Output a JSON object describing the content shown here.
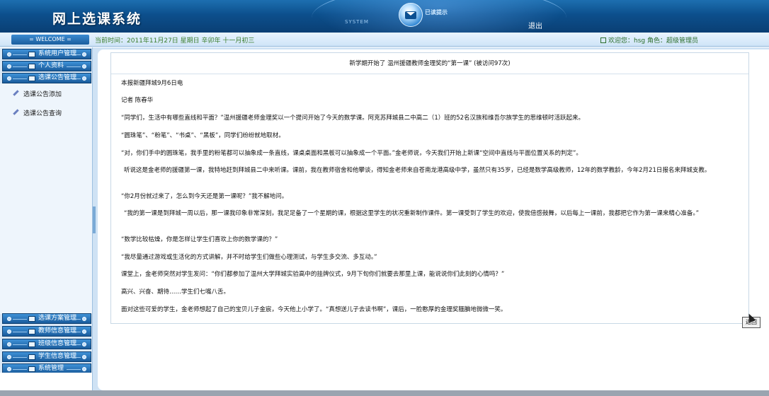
{
  "header": {
    "title": "网上选课系统",
    "system_label": "SYSTEM",
    "mail_label": "已读提示",
    "logout": "退出"
  },
  "status": {
    "welcome": "= WELCOME =",
    "datetime": "当前时间：2011年11月27日 星期日 辛卯年 十一月初三",
    "user": "欢迎您：hsg  角色：超级管理员"
  },
  "sidebar": {
    "menus_top": [
      {
        "label": "系统用户管理"
      },
      {
        "label": "个人资料"
      },
      {
        "label": "选课公告管理"
      }
    ],
    "sub_items": [
      {
        "label": "选课公告添加"
      },
      {
        "label": "选课公告查询"
      }
    ],
    "menus_bottom": [
      {
        "label": "选课方案管理"
      },
      {
        "label": "教师信息管理"
      },
      {
        "label": "班级信息管理"
      },
      {
        "label": "学生信息管理"
      },
      {
        "label": "系统管理"
      }
    ]
  },
  "article": {
    "title": "新学期开始了 温州援疆教师金理奖的“第一课”  (被访问97次)",
    "paragraphs": [
      "本报新疆拜城9月6日电",
      "记者 陈春华",
      "“同学们，生活中有哪些直线和平面？”温州援疆老师金理奖以一个提问开始了今天的数学课。阿克苏拜城县二中高二（1）班的52名汉族和维吾尔族学生的思维顿时活跃起来。",
      "“圆珠笔”、“粉笔”、“书桌”、“黑板”，同学们纷纷就地取材。",
      "“对，你们手中的圆珠笔，我手里的粉笔都可以抽象成一条直线，课桌桌面和黑板可以抽象成一个平面。”金老师说，今天我们开始上新课“空间中直线与平面位置关系的判定”。",
      "听说这是金老师的援疆第一课，我特地赶到拜城县二中来听课。课前，我在教师宿舍和他攀谈，得知金老师来自苍南龙港高级中学，虽然只有35岁，已经是数学高级教师，12年的数学教龄，今年2月21日报名来拜城支教。",
      "“你2月份就过来了，怎么到今天还是第一课呢？”我不解地问。",
      "“我的第一课是到拜城一周以后，那一课我印象非常深刻，我足足备了一个星期的课，根据这里学生的状况重新制作课件。第一课受到了学生的欢迎，使我倍感鼓舞，以后每上一课前，我都把它作为第一课来精心准备。”",
      "“数学比较枯燥，你是怎样让学生们喜欢上你的数学课的？”",
      "“我尽量通过游戏或生活化的方式讲解，并不时给学生们做些心理测试，与学生多交流、多互动。”",
      "课堂上，金老师突然对学生发问：“你们都参加了温州大学拜城实验高中的挂牌仪式，9月下旬你们就要去那里上课，能说说你们此刻的心情吗？”",
      "高兴、兴奋、期待……学生们七嘴八舌。",
      "面对这些可爱的学生，金老师想起了自己的宝贝儿子金宸，今天他上小学了。“真想送儿子去读书啊”，课后，一脸憨厚的金理奖腼腆地微微一笑。"
    ],
    "back_button": "返回"
  },
  "colors": {
    "header_blue": "#0c4f8c",
    "sidebar_bg": "#dbe9f7",
    "status_green": "#3b7d2c"
  },
  "icons": [
    "mail-icon",
    "menu-folder-icon",
    "pencil-icon",
    "user-icon"
  ]
}
